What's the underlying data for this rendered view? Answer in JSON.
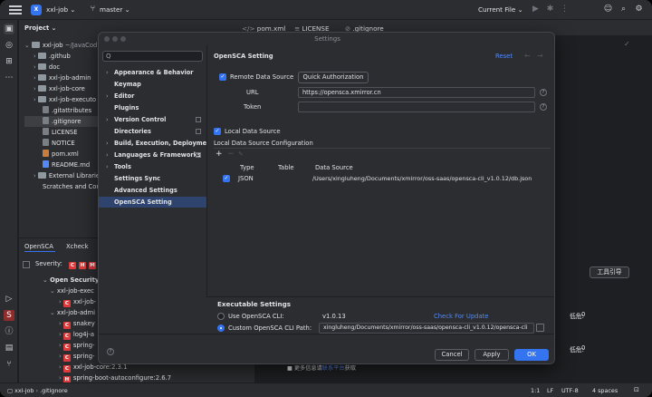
{
  "topbar": {
    "project_badge": "X",
    "project": "xxl-job",
    "branch": "master",
    "run_config": "Current File"
  },
  "editor_tabs": [
    "pom.xml",
    "LICENSE",
    ".gitignore"
  ],
  "project_panel": {
    "title": "Project",
    "root": "xxl-job",
    "root_path": "~/JavaCod",
    "items": [
      ".github",
      "doc",
      "xxl-job-admin",
      "xxl-job-core",
      "xxl-job-executo",
      ".gitattributes",
      ".gitignore",
      "LICENSE",
      "NOTICE",
      "pom.xml",
      "README.md",
      "External Libraries",
      "Scratches and Con"
    ]
  },
  "bottom_panel": {
    "tabs": [
      "OpenSCA",
      "Xcheck"
    ],
    "severity_label": "Severity:",
    "severity_badges": [
      "C",
      "H",
      "M"
    ],
    "rows": [
      "Open Security S",
      "xxl-job-exec",
      "xxl-job-",
      "xxl-job-admi",
      "snakey",
      "log4j-a",
      "spring-",
      "spring-",
      "xxl-job-core:2.3.1",
      "spring-boot-autoconfigure:2.6.7"
    ]
  },
  "right_fragments": {
    "tool_button": "工具引导",
    "risk1_label": "低危:",
    "risk1_value": "0",
    "risk2_label": "低危:",
    "risk2_value": "0",
    "footer_text": "更多信息请",
    "footer_link": "联系平台",
    "footer_suffix": "获取"
  },
  "statusbar": {
    "project": "xxl-job",
    "file": ".gitignore",
    "position": "1:1",
    "line_sep": "LF",
    "encoding": "UTF-8",
    "indent": "4 spaces"
  },
  "dialog": {
    "title": "Settings",
    "search_placeholder": "Q",
    "nav": [
      {
        "label": "Appearance & Behavior",
        "arrow": true
      },
      {
        "label": "Keymap",
        "arrow": false
      },
      {
        "label": "Editor",
        "arrow": true
      },
      {
        "label": "Plugins",
        "arrow": false
      },
      {
        "label": "Version Control",
        "arrow": true
      },
      {
        "label": "Directories",
        "arrow": false
      },
      {
        "label": "Build, Execution, Deployment",
        "arrow": true
      },
      {
        "label": "Languages & Frameworks",
        "arrow": true
      },
      {
        "label": "Tools",
        "arrow": true
      },
      {
        "label": "Settings Sync",
        "arrow": false
      },
      {
        "label": "Advanced Settings",
        "arrow": false
      },
      {
        "label": "OpenSCA Setting",
        "arrow": false
      }
    ],
    "page_title": "OpenSCA Setting",
    "reset": "Reset",
    "remote_source_label": "Remote Data Source",
    "quick_auth_button": "Quick Authorization",
    "url_label": "URL",
    "url_value": "https://opensca.xmirror.cn",
    "token_label": "Token",
    "token_value": "",
    "local_source_label": "Local Data Source",
    "local_config_label": "Local Data Source Configuration",
    "table_headers": [
      "Type",
      "Table",
      "Data Source"
    ],
    "table_rows": [
      {
        "type": "JSON",
        "table": "",
        "source": "/Users/xingluheng/Documents/xmirror/oss-saas/opensca-cli_v1.0.12/db.json"
      }
    ],
    "exec_title": "Executable Settings",
    "use_cli_label": "Use OpenSCA CLI:",
    "cli_version": "v1.0.13",
    "check_update": "Check For Update",
    "custom_cli_label": "Custom OpenSCA CLI Path:",
    "custom_cli_path": "xingluheng/Documents/xmirror/oss-saas/opensca-cli_v1.0.12/opensca-cli",
    "cancel": "Cancel",
    "apply": "Apply",
    "ok": "OK"
  }
}
